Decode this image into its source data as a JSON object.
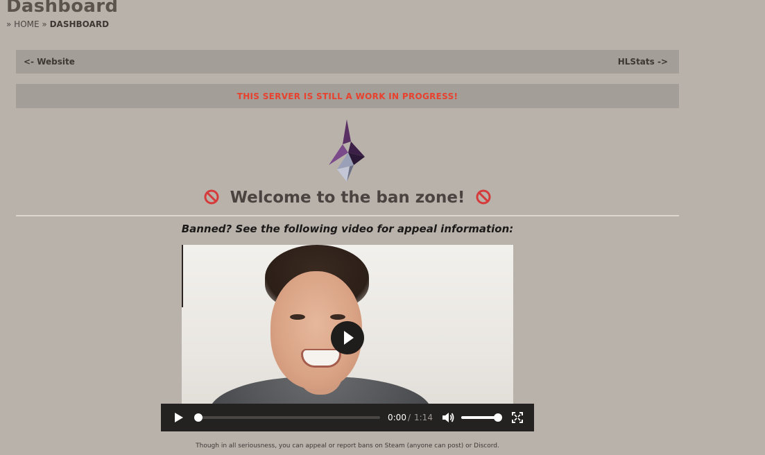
{
  "page": {
    "title": "Dashboard",
    "breadcrumb": {
      "sep": "»",
      "home": "HOME",
      "current": "DASHBOARD"
    }
  },
  "nav": {
    "back_label": "<- Website",
    "forward_label": "HLStats ->"
  },
  "notice": {
    "text": "THIS SERVER IS STILL A WORK IN PROGRESS!",
    "color": "#e8412e"
  },
  "logo": {
    "icon": "server-logo-icon"
  },
  "welcome": {
    "text": "Welcome to the ban zone!",
    "icon": "no-entry-sign-icon"
  },
  "appeal": {
    "text": "Banned? See the following video for appeal information:"
  },
  "video": {
    "current_time": "0:00",
    "time_sep": "/",
    "duration": "1:14",
    "progress": 0,
    "volume": 1.0
  },
  "footnote": {
    "text": "Though in all seriousness, you can appeal or report bans on Steam (anyone can post) or Discord."
  },
  "colors": {
    "background": "#b8b2ab",
    "bar": "#a39e98",
    "accent": "#e8412e"
  }
}
